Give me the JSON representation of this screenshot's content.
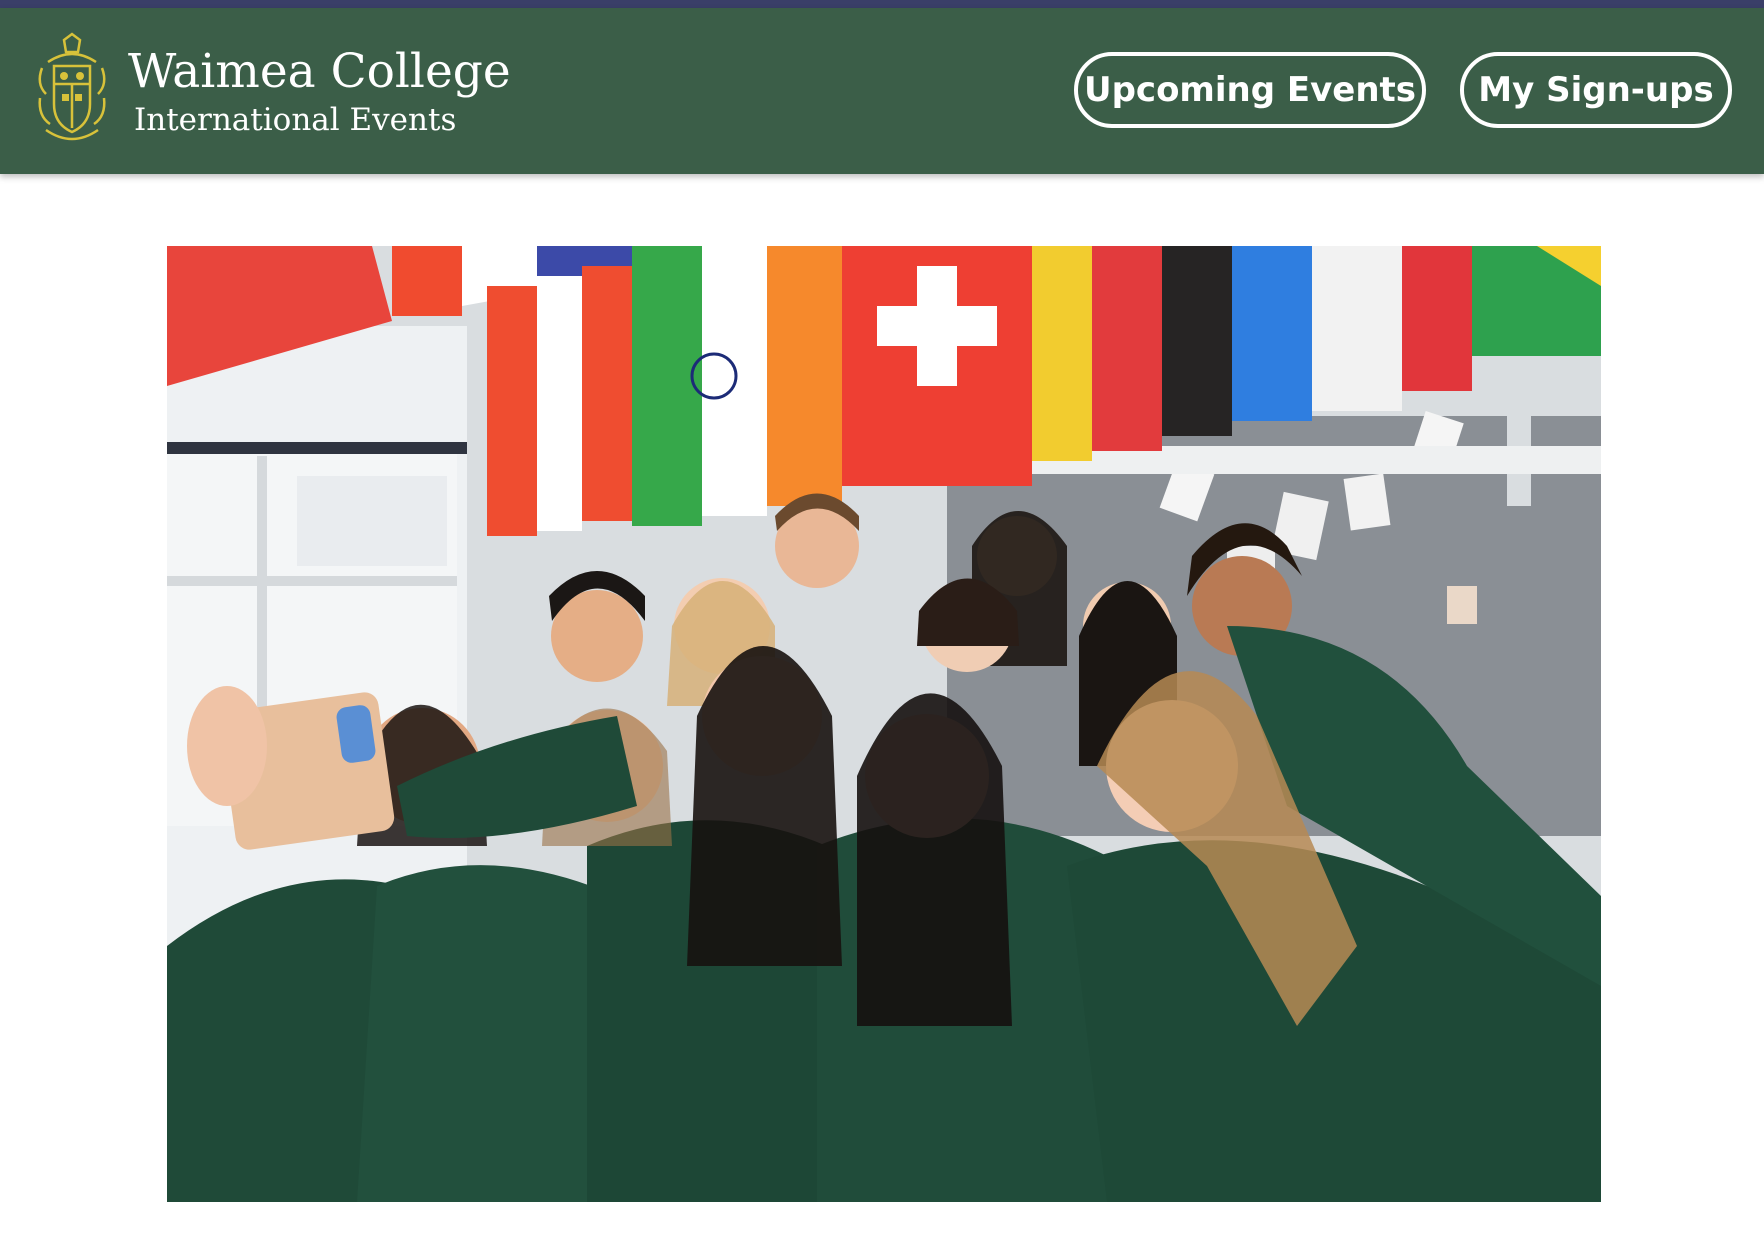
{
  "header": {
    "title": "Waimea College",
    "subtitle": "International Events",
    "logo": "waimea-college-crest",
    "nav": {
      "upcoming_events": "Upcoming Events",
      "my_signups": "My Sign-ups"
    }
  },
  "hero": {
    "image": "students-group-selfie-with-flags"
  },
  "colors": {
    "header_bg": "#3b5e48",
    "top_strip": "#3a3f68",
    "crest_gold": "#d8c23a",
    "uniform_green": "#1f4a38"
  }
}
